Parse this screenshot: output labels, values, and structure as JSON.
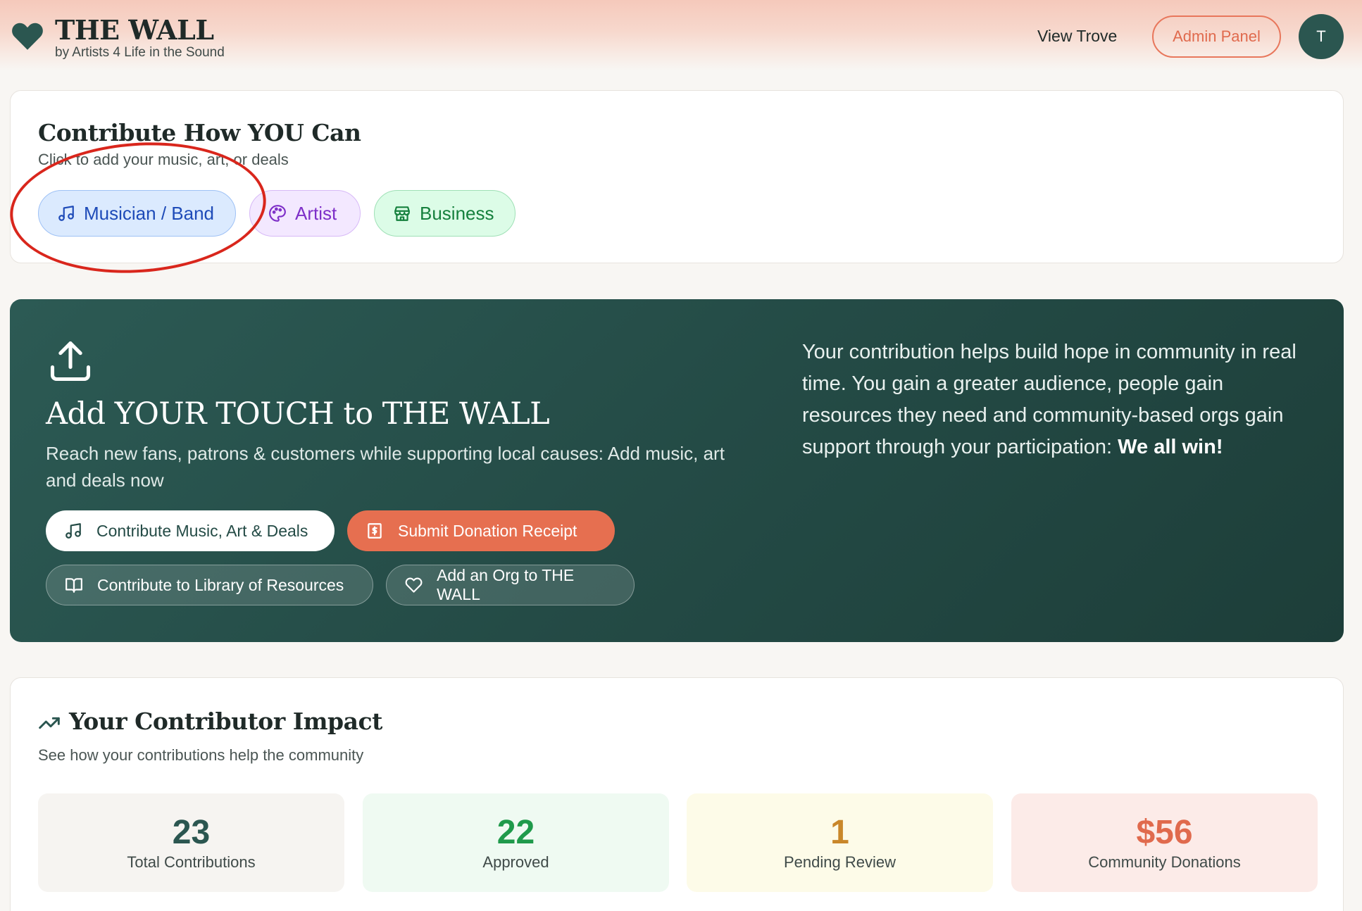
{
  "header": {
    "title": "THE WALL",
    "subtitle": "by Artists 4 Life in the Sound",
    "nav_view_trove": "View Trove",
    "admin_panel": "Admin Panel",
    "avatar_initial": "T"
  },
  "contribute": {
    "title": "Contribute How YOU Can",
    "subtitle": "Click to add your music, art, or deals",
    "pills": [
      {
        "label": "Musician / Band",
        "icon": "music-note-icon"
      },
      {
        "label": "Artist",
        "icon": "palette-icon"
      },
      {
        "label": "Business",
        "icon": "storefront-icon"
      }
    ]
  },
  "touch": {
    "title": "Add YOUR TOUCH to THE WALL",
    "subtitle": "Reach new fans, patrons & customers while supporting local causes: Add music, art and deals now",
    "right_text": "Your contribution helps build hope in community in real time. You gain a greater audience, people gain resources they need and community-based orgs gain support through your participation:",
    "right_emphasis": "We all win!",
    "buttons": {
      "music_art_deals": "Contribute Music, Art & Deals",
      "donation_receipt": "Submit Donation Receipt",
      "library": "Contribute to Library of Resources",
      "add_org": "Add an Org to THE WALL"
    }
  },
  "impact": {
    "title": "Your Contributor Impact",
    "subtitle": "See how your contributions help the community",
    "stats": [
      {
        "value": "23",
        "label": "Total Contributions"
      },
      {
        "value": "22",
        "label": "Approved"
      },
      {
        "value": "1",
        "label": "Pending Review"
      },
      {
        "value": "$56",
        "label": "Community Donations"
      }
    ]
  },
  "colors": {
    "brand_green": "#2b5650",
    "accent_orange": "#e66f50",
    "annotation_red": "#d9261c"
  }
}
